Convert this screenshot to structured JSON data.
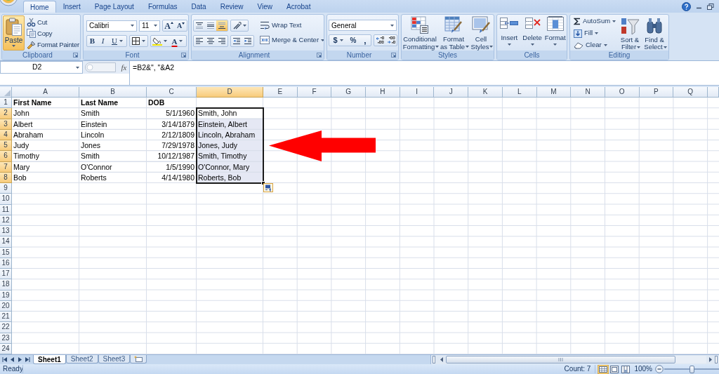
{
  "ribbon_tabs": [
    {
      "label": "Home",
      "selected": true
    },
    {
      "label": "Insert",
      "selected": false
    },
    {
      "label": "Page Layout",
      "selected": false
    },
    {
      "label": "Formulas",
      "selected": false
    },
    {
      "label": "Data",
      "selected": false
    },
    {
      "label": "Review",
      "selected": false
    },
    {
      "label": "View",
      "selected": false
    },
    {
      "label": "Acrobat",
      "selected": false
    }
  ],
  "ribbon": {
    "clipboard": {
      "title": "Clipboard",
      "paste": {
        "label": "Paste",
        "highlighted": true
      },
      "actions": [
        "Cut",
        "Copy",
        "Format Painter"
      ]
    },
    "font": {
      "title": "Font",
      "font_name": "Calibri",
      "font_size": "11",
      "grow_font": "A",
      "shrink_font": "A",
      "bold": "B",
      "italic": "I",
      "underline": "U",
      "font_color": "A"
    },
    "alignment": {
      "title": "Alignment",
      "vertical_align": [
        {
          "selected": false
        },
        {
          "selected": false
        },
        {
          "selected": true
        }
      ],
      "horizontal_align": [
        {
          "selected": false
        },
        {
          "selected": false
        },
        {
          "selected": false
        }
      ],
      "wrap_text": "Wrap Text",
      "merge": "Merge & Center"
    },
    "number": {
      "title": "Number",
      "format": "General",
      "currency": "$",
      "percent": "%",
      "comma": ","
    },
    "styles": {
      "title": "Styles",
      "buttons": [
        "Conditional Formatting",
        "Format as Table",
        "Cell Styles"
      ]
    },
    "cells": {
      "title": "Cells",
      "buttons": [
        "Insert",
        "Delete",
        "Format"
      ]
    },
    "editing": {
      "title": "Editing",
      "actions": [
        "AutoSum",
        "Fill",
        "Clear"
      ],
      "buttons": [
        "Sort & Filter",
        "Find & Select"
      ]
    }
  },
  "formula_bar": {
    "name_box": "D2",
    "function_button": "fx",
    "formula": "=B2&\", \"&A2"
  },
  "sheet": {
    "columns": [
      {
        "label": "A",
        "selected": false
      },
      {
        "label": "B",
        "selected": false
      },
      {
        "label": "C",
        "selected": false
      },
      {
        "label": "D",
        "selected": true
      },
      {
        "label": "E",
        "selected": false
      },
      {
        "label": "F",
        "selected": false
      },
      {
        "label": "G",
        "selected": false
      },
      {
        "label": "H",
        "selected": false
      },
      {
        "label": "I",
        "selected": false
      },
      {
        "label": "J",
        "selected": false
      },
      {
        "label": "K",
        "selected": false
      },
      {
        "label": "L",
        "selected": false
      },
      {
        "label": "M",
        "selected": false
      },
      {
        "label": "N",
        "selected": false
      },
      {
        "label": "O",
        "selected": false
      },
      {
        "label": "P",
        "selected": false
      },
      {
        "label": "Q",
        "selected": false
      }
    ],
    "rows": [
      {
        "label": "1",
        "selected": false,
        "cells": [
          {
            "text": "First Name",
            "kind": "heading"
          },
          {
            "text": "Last Name",
            "kind": "heading"
          },
          {
            "text": "DOB",
            "kind": "heading"
          }
        ]
      },
      {
        "label": "2",
        "selected": true,
        "cells": [
          {
            "text": "John",
            "kind": "text"
          },
          {
            "text": "Smith",
            "kind": "text"
          },
          {
            "text": "5/1/1960",
            "kind": "date"
          },
          {
            "text": "Smith, John",
            "kind": "text"
          }
        ]
      },
      {
        "label": "3",
        "selected": true,
        "cells": [
          {
            "text": "Albert",
            "kind": "text"
          },
          {
            "text": "Einstein",
            "kind": "text"
          },
          {
            "text": "3/14/1879",
            "kind": "date"
          },
          {
            "text": "Einstein, Albert",
            "kind": "text"
          }
        ]
      },
      {
        "label": "4",
        "selected": true,
        "cells": [
          {
            "text": "Abraham",
            "kind": "text"
          },
          {
            "text": "Lincoln",
            "kind": "text"
          },
          {
            "text": "2/12/1809",
            "kind": "date"
          },
          {
            "text": "Lincoln, Abraham",
            "kind": "text"
          }
        ]
      },
      {
        "label": "5",
        "selected": true,
        "cells": [
          {
            "text": "Judy",
            "kind": "text"
          },
          {
            "text": "Jones",
            "kind": "text"
          },
          {
            "text": "7/29/1978",
            "kind": "date"
          },
          {
            "text": "Jones, Judy",
            "kind": "text"
          }
        ]
      },
      {
        "label": "6",
        "selected": true,
        "cells": [
          {
            "text": "Timothy",
            "kind": "text"
          },
          {
            "text": "Smith",
            "kind": "text"
          },
          {
            "text": "10/12/1987",
            "kind": "date"
          },
          {
            "text": "Smith, Timothy",
            "kind": "text"
          }
        ]
      },
      {
        "label": "7",
        "selected": true,
        "cells": [
          {
            "text": "Mary",
            "kind": "text"
          },
          {
            "text": "O'Connor",
            "kind": "text"
          },
          {
            "text": "1/5/1990",
            "kind": "date"
          },
          {
            "text": "O'Connor, Mary",
            "kind": "text"
          }
        ]
      },
      {
        "label": "8",
        "selected": true,
        "cells": [
          {
            "text": "Bob",
            "kind": "text"
          },
          {
            "text": "Roberts",
            "kind": "text"
          },
          {
            "text": "4/14/1980",
            "kind": "date"
          },
          {
            "text": "Roberts, Bob",
            "kind": "text"
          }
        ]
      },
      {
        "label": "9",
        "selected": false
      },
      {
        "label": "10",
        "selected": false
      },
      {
        "label": "11",
        "selected": false
      },
      {
        "label": "12",
        "selected": false
      },
      {
        "label": "13",
        "selected": false
      },
      {
        "label": "14",
        "selected": false
      },
      {
        "label": "15",
        "selected": false
      },
      {
        "label": "16",
        "selected": false
      },
      {
        "label": "17",
        "selected": false
      },
      {
        "label": "18",
        "selected": false
      },
      {
        "label": "19",
        "selected": false
      },
      {
        "label": "20",
        "selected": false
      },
      {
        "label": "21",
        "selected": false
      },
      {
        "label": "22",
        "selected": false
      },
      {
        "label": "23",
        "selected": false
      },
      {
        "label": "24",
        "selected": false
      }
    ]
  },
  "annotations": [
    {
      "kind": "arrow"
    }
  ],
  "sheet_tabs": [
    {
      "label": "Sheet1",
      "selected": true
    },
    {
      "label": "Sheet2",
      "selected": false
    },
    {
      "label": "Sheet3",
      "selected": false
    }
  ],
  "status_bar": {
    "mode": "Ready",
    "count": "Count: 7",
    "views": [
      {
        "selected": true
      },
      {
        "selected": false
      },
      {
        "selected": false
      }
    ],
    "zoom": "100%",
    "zoom_slider": {
      "level": 0.5
    }
  }
}
